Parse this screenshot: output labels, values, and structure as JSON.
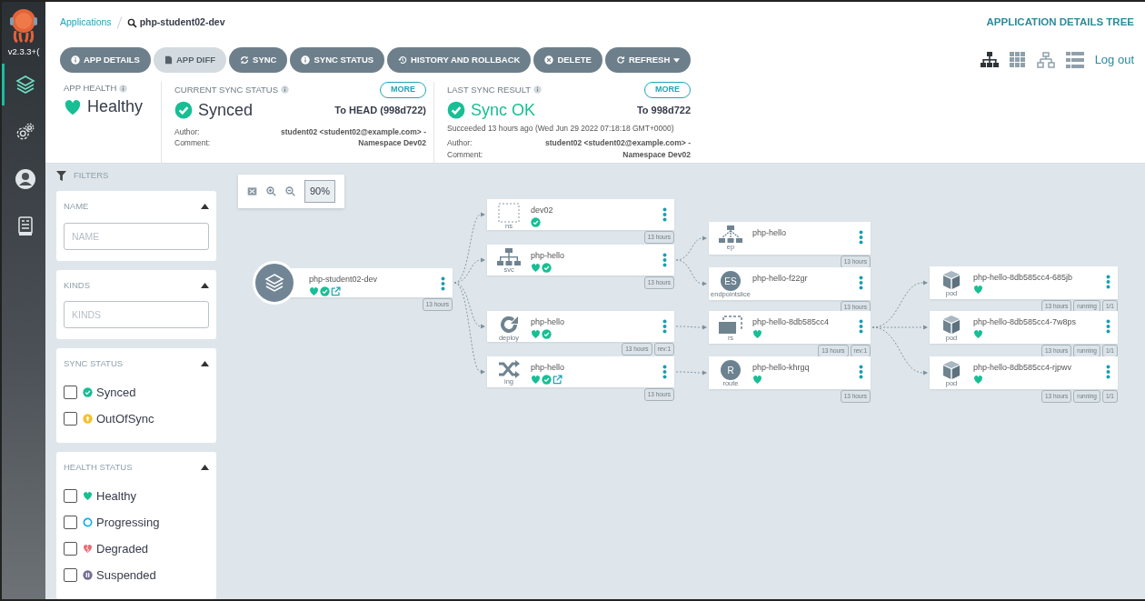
{
  "sidebar": {
    "version": "v2.3.3+(",
    "nav": [
      {
        "kind": "applications",
        "selected": true
      },
      {
        "kind": "settings",
        "selected": false
      },
      {
        "kind": "user",
        "selected": false
      },
      {
        "kind": "docs",
        "selected": false
      }
    ]
  },
  "breadcrumb": {
    "link": "Applications",
    "current": "php-student02-dev"
  },
  "page_title": "APPLICATION DETAILS TREE",
  "toolbar": [
    {
      "label": "APP DETAILS",
      "kind": "info",
      "disabled": false
    },
    {
      "label": "APP DIFF",
      "kind": "file",
      "disabled": true
    },
    {
      "label": "SYNC",
      "kind": "sync",
      "disabled": false
    },
    {
      "label": "SYNC STATUS",
      "kind": "info",
      "disabled": false
    },
    {
      "label": "HISTORY AND ROLLBACK",
      "kind": "history",
      "disabled": false
    },
    {
      "label": "DELETE",
      "kind": "delete",
      "disabled": false
    },
    {
      "label": "REFRESH",
      "kind": "refresh",
      "disabled": false,
      "dropdown": true
    }
  ],
  "views": [
    {
      "kind": "tree",
      "selected": true
    },
    {
      "kind": "grid",
      "selected": false
    },
    {
      "kind": "network",
      "selected": false
    },
    {
      "kind": "list",
      "selected": false
    }
  ],
  "logout": "Log out",
  "app_health": {
    "title": "APP HEALTH",
    "status": "Healthy"
  },
  "current_sync": {
    "title": "CURRENT SYNC STATUS",
    "more": "MORE",
    "status": "Synced",
    "target": "To HEAD (998d722)",
    "author_label": "Author:",
    "comment_label": "Comment:",
    "author": "student02 <student02@example.com> -",
    "comment": "Namespace Dev02"
  },
  "last_sync": {
    "title": "LAST SYNC RESULT",
    "more": "MORE",
    "status": "Sync OK",
    "target": "To 998d722",
    "detail": "Succeeded 13 hours ago (Wed Jun 29 2022 07:18:18 GMT+0000)",
    "author_label": "Author:",
    "comment_label": "Comment:",
    "author": "student02 <student02@example.com> -",
    "comment": "Namespace Dev02"
  },
  "filters": {
    "title": "FILTERS",
    "sections": [
      {
        "title": "NAME",
        "kind": "field",
        "placeholder": "NAME",
        "expanded": true
      },
      {
        "title": "KINDS",
        "kind": "field",
        "placeholder": "KINDS",
        "expanded": true
      },
      {
        "title": "SYNC STATUS",
        "kind": "checklist",
        "expanded": true,
        "options": [
          {
            "label": "Synced",
            "kind": "synced",
            "checked": false
          },
          {
            "label": "OutOfSync",
            "kind": "outofsync",
            "checked": false
          }
        ]
      },
      {
        "title": "HEALTH STATUS",
        "kind": "checklist",
        "expanded": true,
        "options": [
          {
            "label": "Healthy",
            "kind": "healthy",
            "checked": false
          },
          {
            "label": "Progressing",
            "kind": "progressing",
            "checked": false
          },
          {
            "label": "Degraded",
            "kind": "degraded",
            "checked": false
          },
          {
            "label": "Suspended",
            "kind": "suspended",
            "checked": false
          }
        ]
      }
    ]
  },
  "zoom": "90%",
  "tree": {
    "kind": "app",
    "name": "php-student02-dev",
    "healthy": true,
    "synced": true,
    "link": true,
    "tags": [
      "13 hours"
    ],
    "children": [
      {
        "kind": "ns",
        "kind_label": "ns",
        "name": "dev02",
        "synced": true,
        "tags": [
          "13 hours"
        ]
      },
      {
        "kind": "svc",
        "kind_label": "svc",
        "name": "php-hello",
        "healthy": true,
        "synced": true,
        "tags": [
          "13 hours"
        ],
        "children": [
          {
            "kind": "ep",
            "kind_label": "ep",
            "name": "php-hello",
            "tags": [
              "13 hours"
            ]
          },
          {
            "kind": "endpointslice",
            "kind_label": "endpointslice",
            "icon_text": "ES",
            "name": "php-hello-f22gr",
            "tags": [
              "13 hours"
            ]
          }
        ]
      },
      {
        "kind": "deploy",
        "kind_label": "deploy",
        "name": "php-hello",
        "healthy": true,
        "synced": true,
        "tags": [
          "13 hours",
          "rev:1"
        ],
        "children": [
          {
            "kind": "rs",
            "kind_label": "rs",
            "name": "php-hello-8db585cc4",
            "healthy": true,
            "tags": [
              "13 hours",
              "rev:1"
            ],
            "children": [
              {
                "kind": "pod",
                "kind_label": "pod",
                "name": "php-hello-8db585cc4-685jb",
                "healthy": true,
                "tags": [
                  "13 hours",
                  "running",
                  "1/1"
                ]
              },
              {
                "kind": "pod",
                "kind_label": "pod",
                "name": "php-hello-8db585cc4-7w8ps",
                "healthy": true,
                "tags": [
                  "13 hours",
                  "running",
                  "1/1"
                ]
              },
              {
                "kind": "pod",
                "kind_label": "pod",
                "name": "php-hello-8db585cc4-rjpwv",
                "healthy": true,
                "tags": [
                  "13 hours",
                  "running",
                  "1/1"
                ]
              }
            ]
          }
        ]
      },
      {
        "kind": "ing",
        "kind_label": "ing",
        "name": "php-hello",
        "healthy": true,
        "synced": true,
        "link": true,
        "tags": [
          "13 hours"
        ],
        "children": [
          {
            "kind": "route",
            "kind_label": "route",
            "icon_text": "R",
            "name": "php-hello-khrgq",
            "healthy": true,
            "tags": [
              "13 hours"
            ]
          }
        ]
      }
    ]
  }
}
